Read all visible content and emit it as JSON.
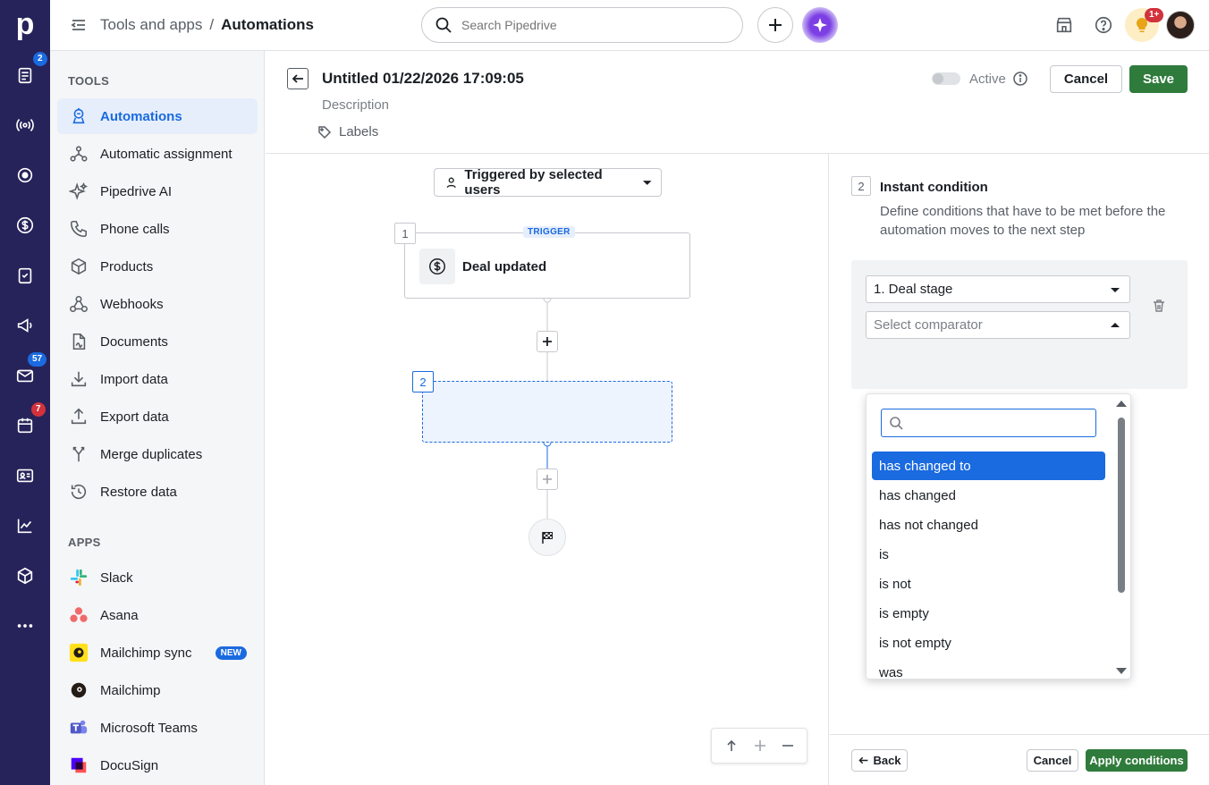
{
  "rail": {
    "logo": "p",
    "badges": {
      "leads": "2",
      "mail": "57",
      "calendar": "7"
    }
  },
  "topbar": {
    "breadcrumb_parent": "Tools and apps",
    "breadcrumb_sep": "/",
    "breadcrumb_current": "Automations",
    "search_placeholder": "Search Pipedrive",
    "notif_badge": "1+"
  },
  "sidebar": {
    "tools_title": "TOOLS",
    "tools": [
      {
        "label": "Automations",
        "icon": "automations-icon"
      },
      {
        "label": "Automatic assignment",
        "icon": "assignment-icon"
      },
      {
        "label": "Pipedrive AI",
        "icon": "sparkle-icon"
      },
      {
        "label": "Phone calls",
        "icon": "phone-icon"
      },
      {
        "label": "Products",
        "icon": "box-icon"
      },
      {
        "label": "Webhooks",
        "icon": "webhook-icon"
      },
      {
        "label": "Documents",
        "icon": "document-icon"
      },
      {
        "label": "Import data",
        "icon": "import-icon"
      },
      {
        "label": "Export data",
        "icon": "export-icon"
      },
      {
        "label": "Merge duplicates",
        "icon": "merge-icon"
      },
      {
        "label": "Restore data",
        "icon": "restore-icon"
      }
    ],
    "apps_title": "APPS",
    "apps": [
      {
        "label": "Slack",
        "icon": "slack-icon"
      },
      {
        "label": "Asana",
        "icon": "asana-icon"
      },
      {
        "label": "Mailchimp sync",
        "icon": "mailchimp-icon",
        "badge": "NEW"
      },
      {
        "label": "Mailchimp",
        "icon": "mailchimp-icon"
      },
      {
        "label": "Microsoft Teams",
        "icon": "teams-icon"
      },
      {
        "label": "DocuSign",
        "icon": "docusign-icon"
      }
    ]
  },
  "header": {
    "title": "Untitled 01/22/2026 17:09:05",
    "description": "Description",
    "labels": "Labels",
    "active_label": "Active",
    "cancel": "Cancel",
    "save": "Save"
  },
  "canvas": {
    "trigger_mode": "Triggered by selected users",
    "step1_number": "1",
    "trigger_tag": "TRIGGER",
    "step1_label": "Deal updated",
    "step2_number": "2"
  },
  "panel": {
    "step_number": "2",
    "title": "Instant condition",
    "description": "Define conditions that have to be met before the automation moves to the next step",
    "field_select": "1. Deal stage",
    "comparator_placeholder": "Select comparator",
    "options": [
      "has changed to",
      "has changed",
      "has not changed",
      "is",
      "is not",
      "is empty",
      "is not empty",
      "was"
    ],
    "selected_option": "has changed to",
    "back": "Back",
    "cancel": "Cancel",
    "apply": "Apply conditions"
  },
  "colors": {
    "rail": "#26235a",
    "accent": "#1a6ae0",
    "save": "#2f7b3c",
    "active_bg": "#e6eefc"
  }
}
